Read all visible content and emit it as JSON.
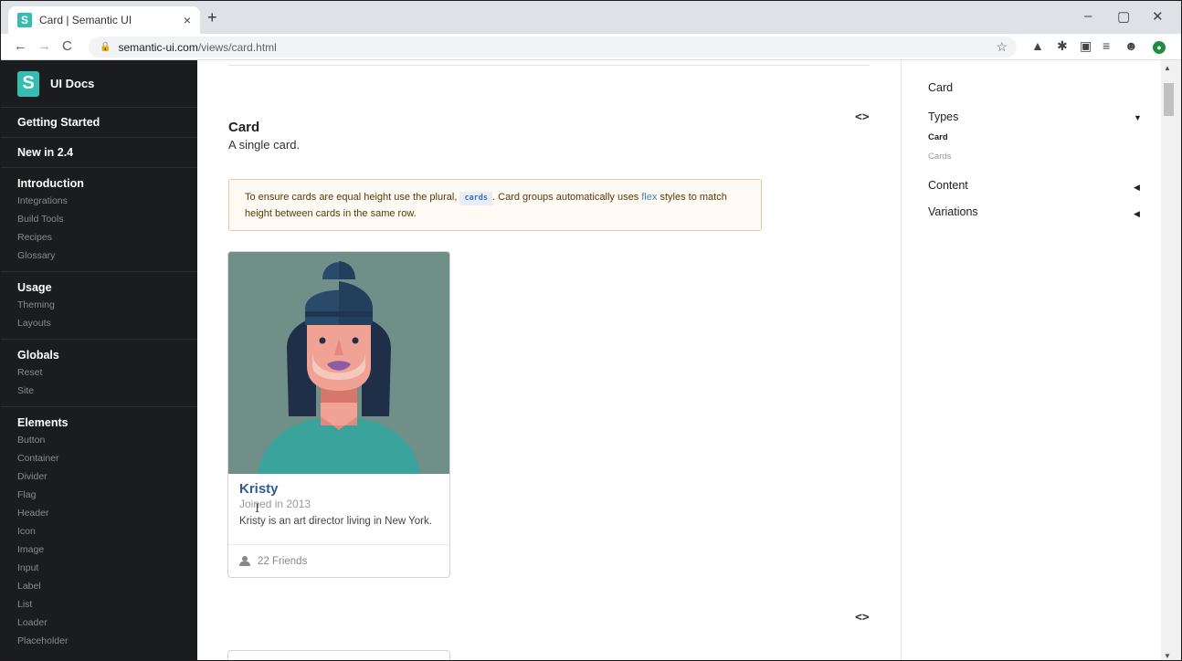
{
  "browser": {
    "tab_title": "Card | Semantic UI",
    "tab_favicon": "S",
    "tab_close": "×",
    "new_tab": "+",
    "minimize": "–",
    "restore": "▢",
    "close": "✕",
    "back": "←",
    "forward": "→",
    "reload": "C",
    "url_host": "semantic-ui.com",
    "url_path": "/views/card.html",
    "bookmark_icon": "star-icon"
  },
  "sidebar": {
    "logo": "S",
    "brand": "UI Docs",
    "top_items": [
      "Getting Started",
      "New in 2.4"
    ],
    "groups": [
      {
        "title": "Introduction",
        "items": [
          "Integrations",
          "Build Tools",
          "Recipes",
          "Glossary"
        ]
      },
      {
        "title": "Usage",
        "items": [
          "Theming",
          "Layouts"
        ]
      },
      {
        "title": "Globals",
        "items": [
          "Reset",
          "Site"
        ]
      },
      {
        "title": "Elements",
        "items": [
          "Button",
          "Container",
          "Divider",
          "Flag",
          "Header",
          "Icon",
          "Image",
          "Input",
          "Label",
          "List",
          "Loader",
          "Placeholder"
        ]
      }
    ]
  },
  "main": {
    "code_toggle": "<>",
    "example_title": "Card",
    "example_desc": "A single card.",
    "notice": {
      "part1": "To ensure cards are equal height use the plural,",
      "code": "cards",
      "part2": ". Card groups automatically uses",
      "link": "flex",
      "part3": "styles to match height between cards in the same row."
    },
    "card": {
      "header": "Kristy",
      "meta": "Joined in 2013",
      "description": "Kristy is an art director living in New York.",
      "extra": "22 Friends",
      "extra_icon": "user-icon"
    }
  },
  "rail": {
    "title": "Card",
    "sections": [
      {
        "label": "Types",
        "caret": "▼",
        "subs": [
          "Card",
          "Cards"
        ]
      },
      {
        "label": "Content",
        "caret": "◀"
      },
      {
        "label": "Variations",
        "caret": "◀"
      }
    ]
  },
  "colors": {
    "sidebar_bg": "#1b1c1d",
    "brand_teal": "#35bdb2",
    "link_blue": "#4183c4",
    "card_header": "#2f5b93",
    "notice_bg": "#fffaf3"
  }
}
